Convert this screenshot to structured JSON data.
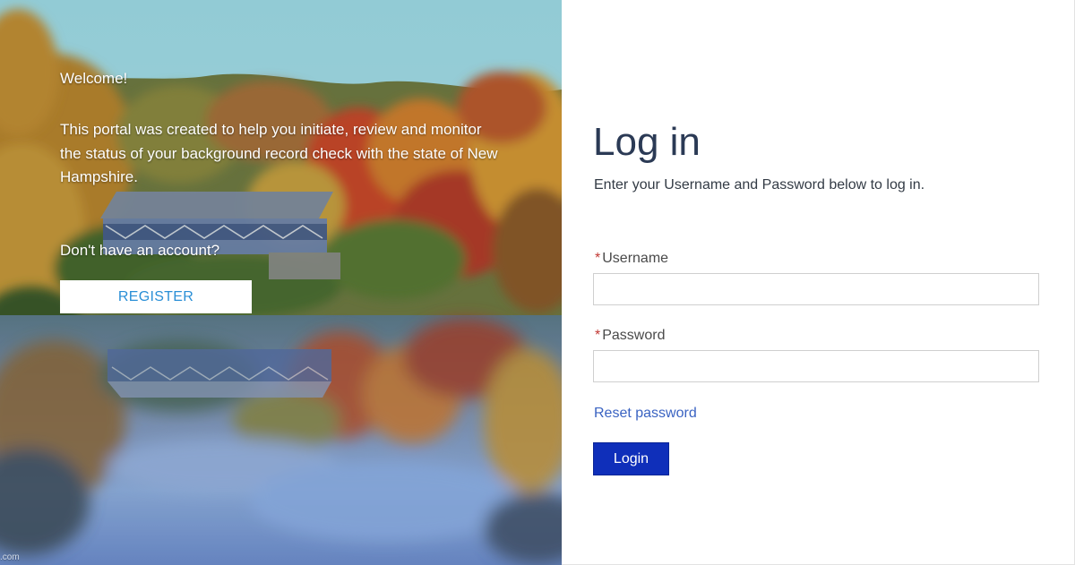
{
  "hero": {
    "welcome": "Welcome!",
    "intro": "This portal was created to help you initiate, review and monitor the status of your background record check with the state of New Hampshire.",
    "no_account": "Don't have an account?",
    "register_label": "REGISTER",
    "watermark": ".com"
  },
  "login": {
    "title": "Log in",
    "subtitle": "Enter your Username and Password below to log in.",
    "required_mark": "*",
    "username_label": "Username",
    "username_value": "",
    "password_label": "Password",
    "password_value": "",
    "reset_link": "Reset password",
    "login_button": "Login"
  },
  "colors": {
    "sky": "#9fdde8",
    "register_text": "#2a8fd6",
    "login_button_bg": "#0f2fba",
    "title_text": "#2b3a55",
    "reset_link": "#3a63c2",
    "required_mark": "#c23934"
  }
}
